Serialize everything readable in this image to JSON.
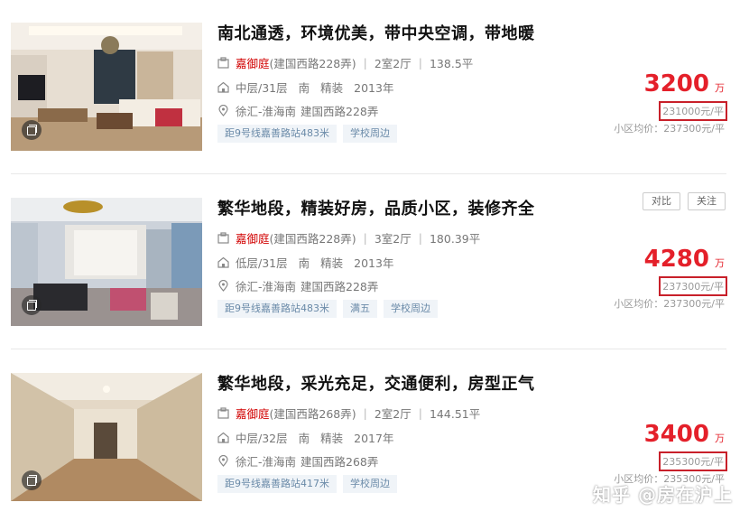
{
  "listings": [
    {
      "title": "南北通透，环境优美，带中央空调，带地暖",
      "community": "嘉御庭",
      "road": "(建国西路228弄)",
      "layout": "2室2厅",
      "area": "138.5平",
      "floor": "中层/31层",
      "orientation": "南",
      "decoration": "精装",
      "year": "2013年",
      "district": "徐汇-淮海南",
      "address": "建国西路228弄",
      "tags": [
        "距9号线嘉善路站483米",
        "学校周边"
      ],
      "price": "3200",
      "price_unit": "万",
      "unit_price": "231000元/平",
      "avg_price": "小区均价：237300元/平"
    },
    {
      "title": "繁华地段，精装好房，品质小区，装修齐全",
      "community": "嘉御庭",
      "road": "(建国西路228弄)",
      "layout": "3室2厅",
      "area": "180.39平",
      "floor": "低层/31层",
      "orientation": "南",
      "decoration": "精装",
      "year": "2013年",
      "district": "徐汇-淮海南",
      "address": "建国西路228弄",
      "tags": [
        "距9号线嘉善路站483米",
        "满五",
        "学校周边"
      ],
      "price": "4280",
      "price_unit": "万",
      "unit_price": "237300元/平",
      "avg_price": "小区均价：237300元/平",
      "compare_label": "对比",
      "follow_label": "关注"
    },
    {
      "title": "繁华地段，采光充足，交通便利，房型正气",
      "community": "嘉御庭",
      "road": "(建国西路268弄)",
      "layout": "2室2厅",
      "area": "144.51平",
      "floor": "中层/32层",
      "orientation": "南",
      "decoration": "精装",
      "year": "2017年",
      "district": "徐汇-淮海南",
      "address": "建国西路268弄",
      "tags": [
        "距9号线嘉善路站417米",
        "学校周边"
      ],
      "price": "3400",
      "price_unit": "万",
      "unit_price": "235300元/平",
      "avg_price": "小区均价：235300元/平"
    }
  ],
  "watermark": "知乎 @房在沪上",
  "colors": {
    "price": "#e4202a",
    "community": "#d10000",
    "highlight_box": "#c8202a",
    "tag_bg": "#f0f4f8"
  },
  "icons": [
    "building-icon",
    "home-icon",
    "location-pin-icon",
    "camera-gallery-icon"
  ]
}
